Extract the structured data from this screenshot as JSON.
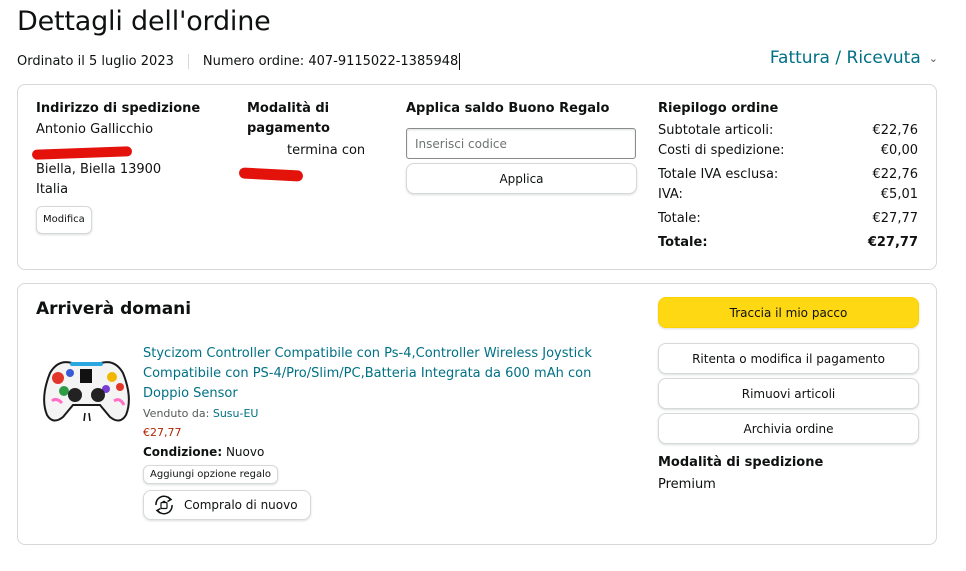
{
  "header": {
    "title": "Dettagli dell'ordine",
    "ordered_on": "Ordinato il 5 luglio 2023",
    "order_number": "Numero ordine: 407-9115022-1385948",
    "invoice_link": "Fattura / Ricevuta"
  },
  "shipping": {
    "title": "Indirizzo di spedizione",
    "name": "Antonio Gallicchio",
    "city": "Biella, Biella 13900",
    "country": "Italia",
    "edit_label": "Modifica"
  },
  "payment": {
    "title": "Modalità di pagamento",
    "card_text": "termina con"
  },
  "gift_card": {
    "title": "Applica saldo Buono Regalo",
    "placeholder": "Inserisci codice",
    "apply_label": "Applica"
  },
  "summary": {
    "title": "Riepilogo ordine",
    "rows": [
      {
        "label": "Subtotale articoli:",
        "value": "€22,76"
      },
      {
        "label": "Costi di spedizione:",
        "value": "€0,00"
      },
      {
        "label": "Totale IVA esclusa:",
        "value": "€22,76"
      },
      {
        "label": "IVA:",
        "value": "€5,01"
      },
      {
        "label": "Totale:",
        "value": "€27,77"
      },
      {
        "label": "Totale:",
        "value": "€27,77"
      }
    ]
  },
  "shipment": {
    "status": "Arriverà domani",
    "product_title": "Stycizom Controller Compatibile con Ps-4,Controller Wireless Joystick Compatibile con PS-4/Pro/Slim/PC,Batteria Integrata da 600 mAh con Doppio Sensor",
    "sold_by_label": "Venduto da:",
    "seller": "Susu-EU",
    "price": "€27,77",
    "condition_label": "Condizione:",
    "condition_value": "Nuovo",
    "gift_option_label": "Aggiungi opzione regalo",
    "buy_again_label": "Compralo di nuovo",
    "icons": {
      "buy_again": "buy-again-icon",
      "dropdown": "chevron-down-icon"
    }
  },
  "actions": {
    "track": "Traccia il mio pacco",
    "retry_payment": "Ritenta o modifica il pagamento",
    "remove_items": "Rimuovi articoli",
    "archive": "Archivia ordine",
    "ship_mode_title": "Modalità di spedizione",
    "ship_mode_value": "Premium"
  },
  "colors": {
    "link": "#007185",
    "primary_button": "#ffd814",
    "price": "#b12704",
    "redaction": "#e3120b"
  }
}
